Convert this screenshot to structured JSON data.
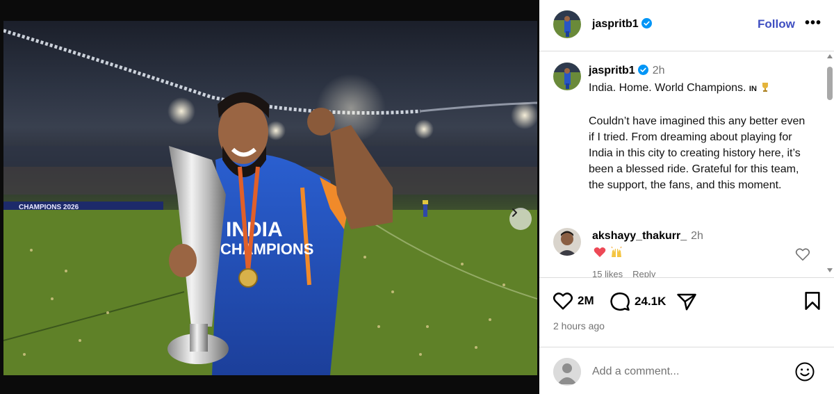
{
  "media": {
    "photo_alt": "",
    "banner_text": "CHAMPIONS 2026",
    "jersey_text_1": "INDIA",
    "jersey_text_2": "CHAMPIONS",
    "carousel": {
      "total": 5,
      "active": 0
    }
  },
  "post": {
    "author": "jaspritb1",
    "follow_label": "Follow",
    "more_label": "•••",
    "caption": {
      "time": "2h",
      "line1": "India. Home. World Champions.",
      "flag": "IN",
      "body": "Couldn’t have imagined this any better even if I tried. From dreaming about playing for India in this city to creating history here, it’s been a blessed ride. Grateful for this team, the support, the fans, and this moment."
    },
    "comment": {
      "author": "akshayy_thakurr_",
      "time": "2h",
      "emojis": [
        "❤️",
        "🙌"
      ],
      "likes": "15 likes",
      "reply_label": "Reply"
    },
    "actions": {
      "likes": "2M",
      "comments": "24.1K"
    },
    "posted": "2 hours ago",
    "add_comment_placeholder": "Add a comment..."
  },
  "colors": {
    "follow": "#3f4fc1",
    "verified": "#0095f6",
    "heart": "#ed4956"
  }
}
